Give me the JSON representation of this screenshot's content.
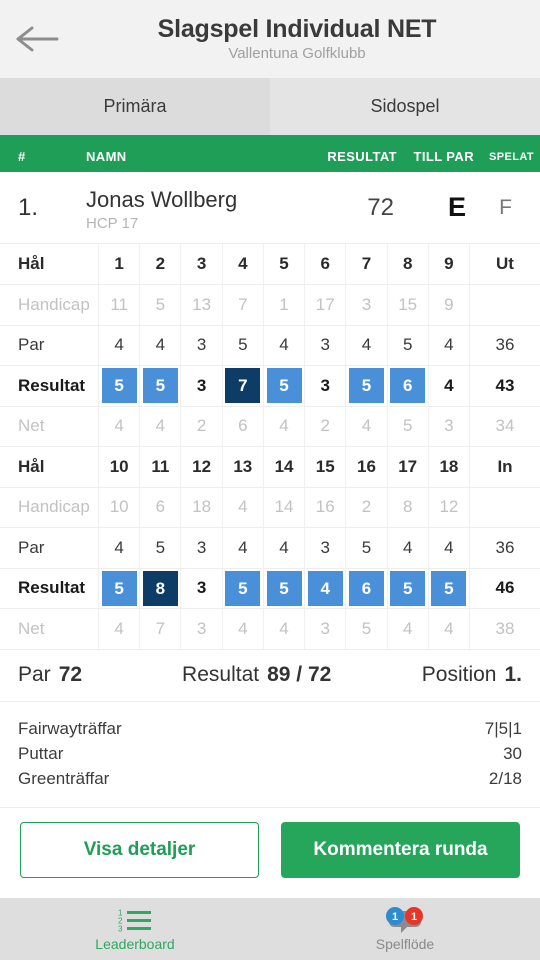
{
  "appbar": {
    "back_icon": "arrow-left-icon",
    "title": "Slagspel Individual NET",
    "subtitle": "Vallentuna Golfklubb"
  },
  "tabs": [
    {
      "label": "Primära",
      "selected": true
    },
    {
      "label": "Sidospel",
      "selected": false
    }
  ],
  "leaderboard_header": {
    "rank": "#",
    "name": "NAMN",
    "result": "RESULTAT",
    "to_par": "TILL PAR",
    "played": "SPELAT"
  },
  "player": {
    "rank": "1.",
    "name": "Jonas Wollberg",
    "hcp": "HCP 17",
    "result": "72",
    "to_par": "E",
    "played": "F"
  },
  "scorecard": {
    "labels": {
      "hole": "Hål",
      "handicap": "Handicap",
      "par": "Par",
      "result": "Resultat",
      "net": "Net"
    },
    "front": {
      "total_label": "Ut",
      "holes": [
        "1",
        "2",
        "3",
        "4",
        "5",
        "6",
        "7",
        "8",
        "9"
      ],
      "handicap": [
        "11",
        "5",
        "13",
        "7",
        "1",
        "17",
        "3",
        "15",
        "9"
      ],
      "par": [
        "4",
        "4",
        "3",
        "5",
        "4",
        "3",
        "4",
        "5",
        "4"
      ],
      "result": [
        "5",
        "5",
        "3",
        "7",
        "5",
        "3",
        "5",
        "6",
        "4"
      ],
      "result_marks": [
        "bogey",
        "bogey",
        "",
        "dbl",
        "bogey",
        "",
        "bogey",
        "bogey",
        ""
      ],
      "net": [
        "4",
        "4",
        "2",
        "6",
        "4",
        "2",
        "4",
        "5",
        "3"
      ],
      "par_total": "36",
      "result_total": "43",
      "net_total": "34"
    },
    "back": {
      "total_label": "In",
      "holes": [
        "10",
        "11",
        "12",
        "13",
        "14",
        "15",
        "16",
        "17",
        "18"
      ],
      "handicap": [
        "10",
        "6",
        "18",
        "4",
        "14",
        "16",
        "2",
        "8",
        "12"
      ],
      "par": [
        "4",
        "5",
        "3",
        "4",
        "4",
        "3",
        "5",
        "4",
        "4"
      ],
      "result": [
        "5",
        "8",
        "3",
        "5",
        "5",
        "4",
        "6",
        "5",
        "5"
      ],
      "result_marks": [
        "bogey",
        "dbl",
        "",
        "bogey",
        "bogey",
        "bogey",
        "bogey",
        "bogey",
        "bogey"
      ],
      "net": [
        "4",
        "7",
        "3",
        "4",
        "4",
        "3",
        "5",
        "4",
        "4"
      ],
      "par_total": "36",
      "result_total": "46",
      "net_total": "38"
    }
  },
  "summary": {
    "par_label": "Par",
    "par_value": "72",
    "result_label": "Resultat",
    "result_value": "89 / 72",
    "position_label": "Position",
    "position_value": "1."
  },
  "stats": [
    {
      "label": "Fairwayträffar",
      "value": "7|5|1"
    },
    {
      "label": "Puttar",
      "value": "30"
    },
    {
      "label": "Greenträffar",
      "value": "2/18"
    }
  ],
  "actions": {
    "details": "Visa detaljer",
    "comment": "Kommentera runda"
  },
  "bottomnav": [
    {
      "label": "Leaderboard",
      "icon": "numbered-list-icon",
      "active": true
    },
    {
      "label": "Spelflöde",
      "icon": "speech-bubble-icon",
      "active": false,
      "badge_blue": "1",
      "badge_red": "1"
    }
  ],
  "colors": {
    "brand_green": "#1e9e57",
    "button_green": "#26a65b",
    "bogey_blue": "#4a90d9",
    "double_navy": "#0d3d66"
  }
}
